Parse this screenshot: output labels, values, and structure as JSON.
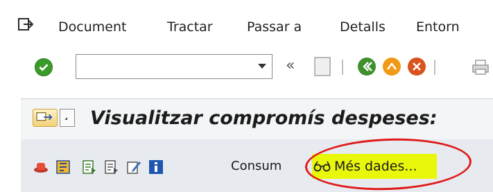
{
  "menubar": {
    "items": [
      "Document",
      "Tractar",
      "Passar a",
      "Detalls",
      "Entorn"
    ]
  },
  "toolbar": {
    "command_value": "",
    "back_symbol": "«"
  },
  "screen": {
    "title": "Visualitzar compromís despeses:"
  },
  "app_toolbar": {
    "consum_label": "Consum",
    "mes_dades_label": "Més dades..."
  },
  "colors": {
    "highlight": "#e9f70a",
    "annotation": "#e01a1a",
    "ok_green": "#3a9a2a"
  }
}
